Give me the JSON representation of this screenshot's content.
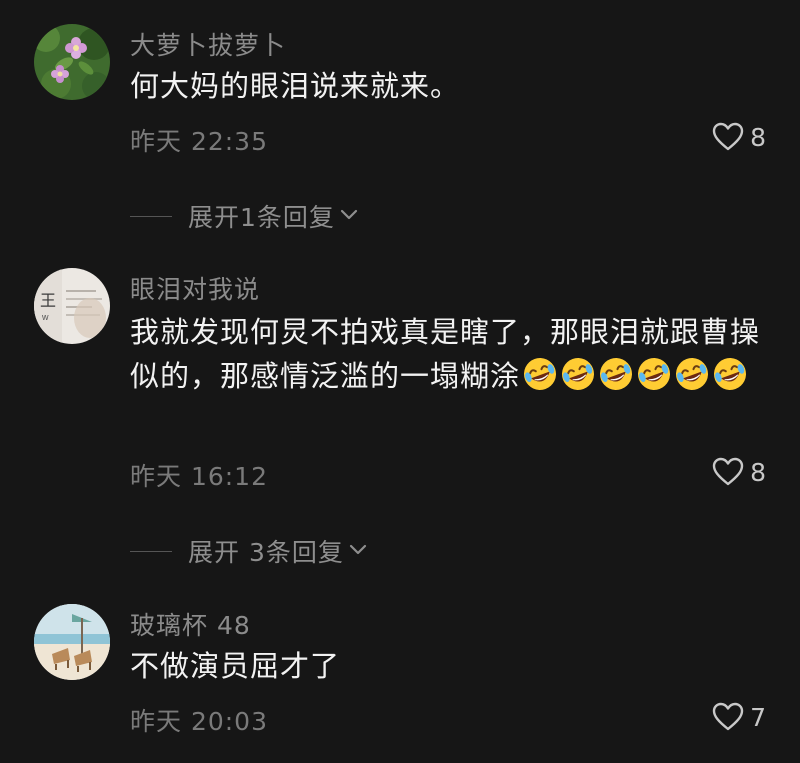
{
  "comments": [
    {
      "username": "大萝卜拔萝卜",
      "text": "何大妈的眼泪说来就来。",
      "time": "昨天 22:35",
      "likes": "8",
      "expand_label": "展开1条回复",
      "avatar_icon": "flower-photo-avatar"
    },
    {
      "username": "眼泪对我说",
      "text": "我就发现何炅不拍戏真是瞎了，那眼泪就跟曹操似的，那感情泛滥的一塌糊涂",
      "emoji_count": 6,
      "emoji_name": "rolling-on-floor-laughing-emoji",
      "time": "昨天 16:12",
      "likes": "8",
      "expand_label": "展开 3条回复",
      "avatar_icon": "text-card-avatar"
    },
    {
      "username": "玻璃杯 48",
      "text": "不做演员屈才了",
      "time": "昨天 20:03",
      "likes": "7",
      "avatar_icon": "beach-chairs-avatar"
    }
  ],
  "colors": {
    "background": "#161616",
    "username": "#8b8b8b",
    "content": "#f2f2f2",
    "meta": "#7a7a7a"
  }
}
